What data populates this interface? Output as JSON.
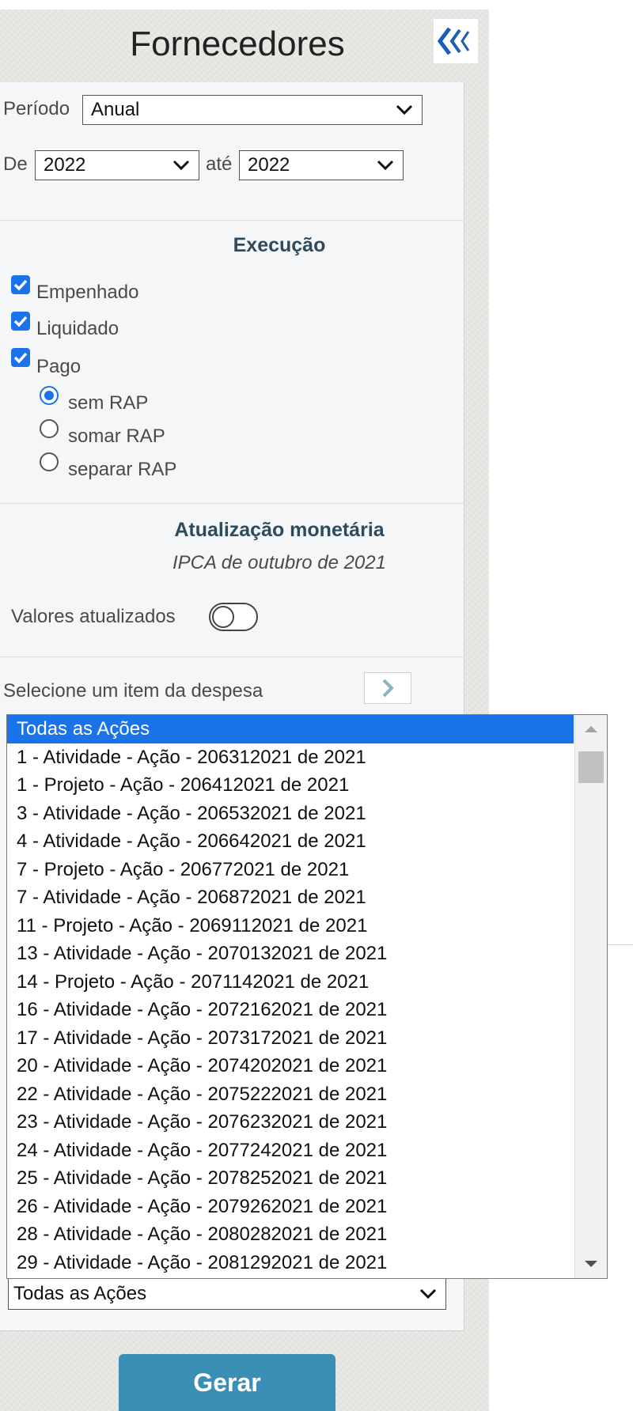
{
  "header": {
    "title": "Fornecedores"
  },
  "filters": {
    "periodo_label": "Período",
    "periodo_value": "Anual",
    "de_label": "De",
    "de_value": "2022",
    "ate_label": "até",
    "ate_value": "2022"
  },
  "execucao": {
    "title": "Execução",
    "checkboxes": [
      {
        "label": "Empenhado",
        "checked": true
      },
      {
        "label": "Liquidado",
        "checked": true
      },
      {
        "label": "Pago",
        "checked": true
      }
    ],
    "radios": [
      {
        "label": "sem RAP",
        "selected": true
      },
      {
        "label": "somar RAP",
        "selected": false
      },
      {
        "label": "separar RAP",
        "selected": false
      }
    ]
  },
  "atualizacao": {
    "title": "Atualização monetária",
    "subtitle": "IPCA de outubro de 2021",
    "toggle_label": "Valores atualizados",
    "toggle_on": false
  },
  "despesa": {
    "prompt": "Selecione um item da despesa",
    "select_value": "Todas as Ações",
    "options": [
      "Todas as Ações",
      "1 - Atividade - Ação - 206312021 de 2021",
      "1 - Projeto - Ação - 206412021 de 2021",
      "3 - Atividade - Ação - 206532021 de 2021",
      "4 - Atividade - Ação - 206642021 de 2021",
      "7 - Projeto - Ação - 206772021 de 2021",
      "7 - Atividade - Ação - 206872021 de 2021",
      "11 - Projeto - Ação - 2069112021 de 2021",
      "13 - Atividade - Ação - 2070132021 de 2021",
      "14 - Projeto - Ação - 2071142021 de 2021",
      "16 - Atividade - Ação - 2072162021 de 2021",
      "17 - Atividade - Ação - 2073172021 de 2021",
      "20 - Atividade - Ação - 2074202021 de 2021",
      "22 - Atividade - Ação - 2075222021 de 2021",
      "23 - Atividade - Ação - 2076232021 de 2021",
      "24 - Atividade - Ação - 2077242021 de 2021",
      "25 - Atividade - Ação - 2078252021 de 2021",
      "26 - Atividade - Ação - 2079262021 de 2021",
      "28 - Atividade - Ação - 2080282021 de 2021",
      "29 - Atividade - Ação - 2081292021 de 2021"
    ]
  },
  "actions": {
    "gerar_label": "Gerar"
  },
  "colors": {
    "accent": "#1a73e8",
    "button": "#3a8fb4",
    "collapse_icon": "#1a5fb4"
  }
}
